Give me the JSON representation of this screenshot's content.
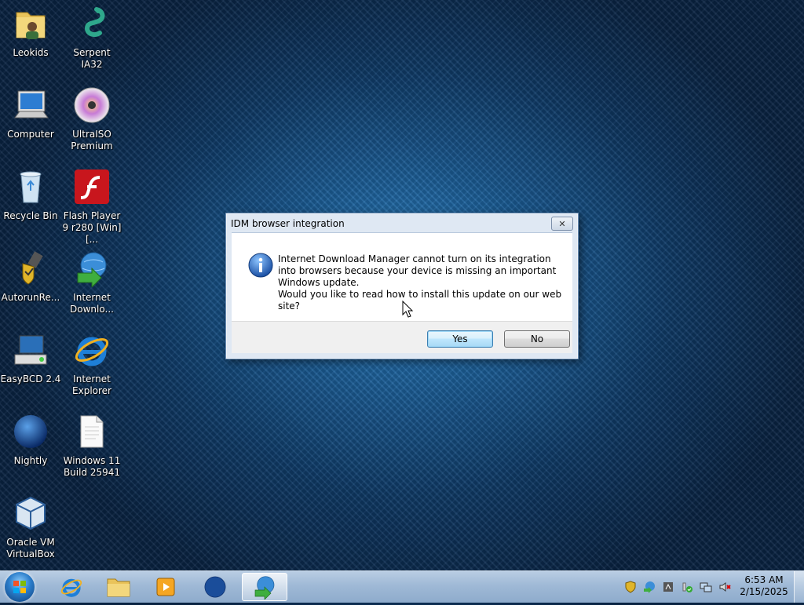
{
  "desktop": {
    "icons": [
      {
        "label": "Leokids"
      },
      {
        "label": "Serpent IA32"
      },
      {
        "label": "Computer"
      },
      {
        "label": "UltraISO Premium"
      },
      {
        "label": "Recycle Bin"
      },
      {
        "label": "Flash Player 9 r280 [Win] [..."
      },
      {
        "label": "AutorunRe..."
      },
      {
        "label": "Internet Downlo..."
      },
      {
        "label": "EasyBCD 2.4"
      },
      {
        "label": "Internet Explorer"
      },
      {
        "label": "Nightly"
      },
      {
        "label": "Windows 11 Build 25941"
      },
      {
        "label": "Oracle VM VirtualBox"
      }
    ]
  },
  "dialog": {
    "title": "IDM browser integration",
    "close_label": "✕",
    "message_line1": "Internet Download Manager cannot turn on its integration into browsers because your device is missing an important Windows update.",
    "message_line2": "Would you like to read how to install this update on our web site?",
    "yes_label": "Yes",
    "no_label": "No"
  },
  "taskbar": {
    "pinned": [
      "internet-explorer",
      "file-explorer",
      "media-player",
      "nightly",
      "internet-download-manager"
    ],
    "active": "internet-download-manager",
    "clock_time": "6:53 AM",
    "clock_date": "2/15/2025"
  },
  "colors": {
    "desktop_accent": "#1b5b93",
    "dialog_frame": "#dfe8f3",
    "default_button": "#bee6fd"
  }
}
